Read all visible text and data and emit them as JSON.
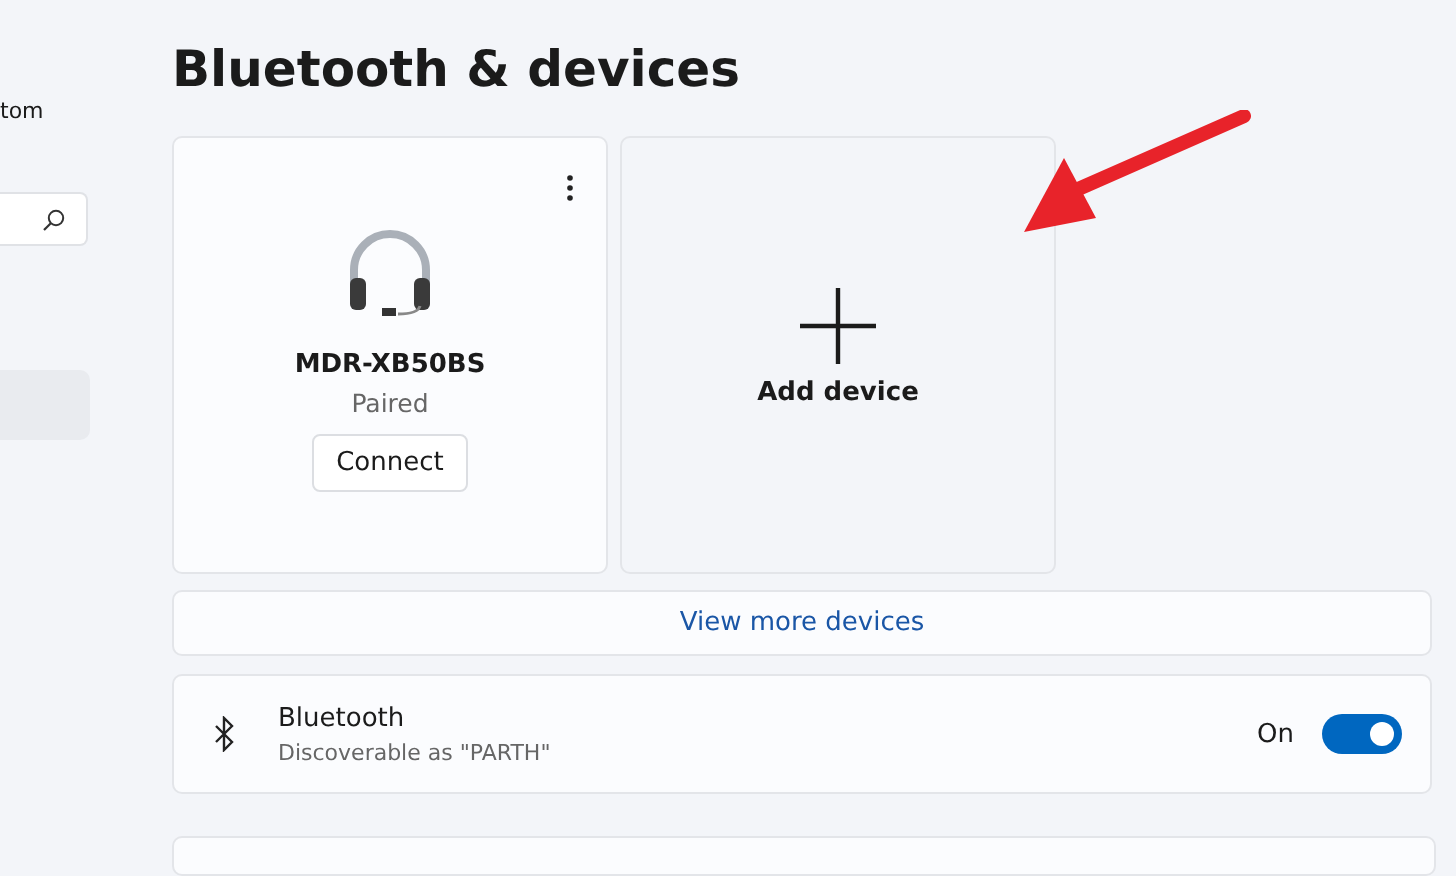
{
  "sidebar": {
    "account_text": "tom",
    "nav_items": [
      {
        "selected": true
      }
    ]
  },
  "page": {
    "title": "Bluetooth & devices"
  },
  "devices": [
    {
      "name": "MDR-XB50BS",
      "status": "Paired",
      "action": "Connect"
    }
  ],
  "add_device": {
    "label": "Add device"
  },
  "view_more": {
    "label": "View more devices"
  },
  "bluetooth": {
    "title": "Bluetooth",
    "subtitle": "Discoverable as \"PARTH\"",
    "state_label": "On",
    "on": true
  }
}
